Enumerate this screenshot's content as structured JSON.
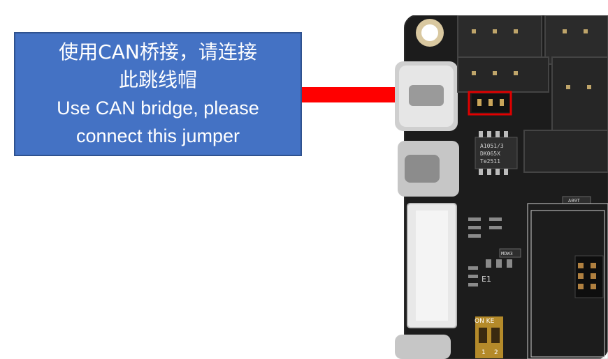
{
  "callout": {
    "line1": "使用CAN桥接，请连接",
    "line2": "此跳线帽",
    "line3": "Use CAN bridge, please",
    "line4": "connect this jumper"
  },
  "board": {
    "ic_label_1": "A1051/3",
    "ic_label_2": "DK065X",
    "ic_label_3": "Te2511",
    "part_label_a091": "A09T",
    "part_label_mdw": "MDW3",
    "label_e1": "E1",
    "dip_label": "ON KE",
    "dip_num_1": "1",
    "dip_num_2": "2"
  },
  "colors": {
    "callout_bg": "#4472c4",
    "arrow": "#ff0000",
    "highlight_box": "#e00000",
    "pcb": "#1a1a1a"
  }
}
